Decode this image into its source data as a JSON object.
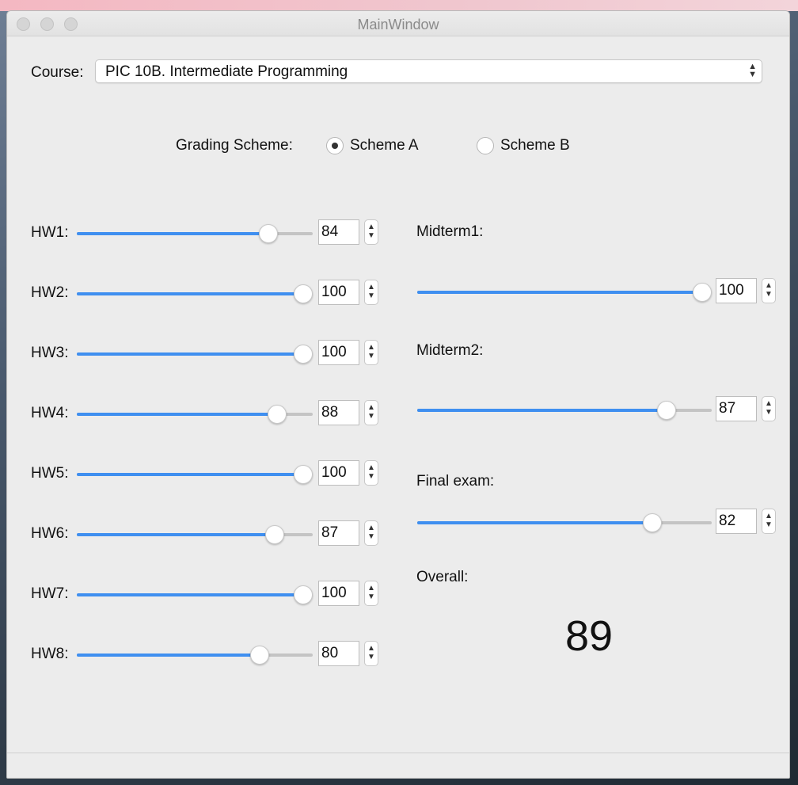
{
  "window": {
    "title": "MainWindow"
  },
  "course": {
    "label": "Course:",
    "selected": "PIC 10B. Intermediate Programming"
  },
  "grading": {
    "label": "Grading Scheme:",
    "options": [
      {
        "label": "Scheme A",
        "checked": true
      },
      {
        "label": "Scheme B",
        "checked": false
      }
    ]
  },
  "slider_range": [
    0,
    100
  ],
  "homework": [
    {
      "label": "HW1:",
      "value": 84
    },
    {
      "label": "HW2:",
      "value": 100
    },
    {
      "label": "HW3:",
      "value": 100
    },
    {
      "label": "HW4:",
      "value": 88
    },
    {
      "label": "HW5:",
      "value": 100
    },
    {
      "label": "HW6:",
      "value": 87
    },
    {
      "label": "HW7:",
      "value": 100
    },
    {
      "label": "HW8:",
      "value": 80
    }
  ],
  "exams": [
    {
      "label": "Midterm1:",
      "value": 100
    },
    {
      "label": "Midterm2:",
      "value": 87
    },
    {
      "label": "Final exam:",
      "value": 82
    }
  ],
  "overall": {
    "label": "Overall:",
    "value": "89"
  },
  "colors": {
    "accent": "#3f8ff0",
    "window_bg": "#ececec"
  }
}
